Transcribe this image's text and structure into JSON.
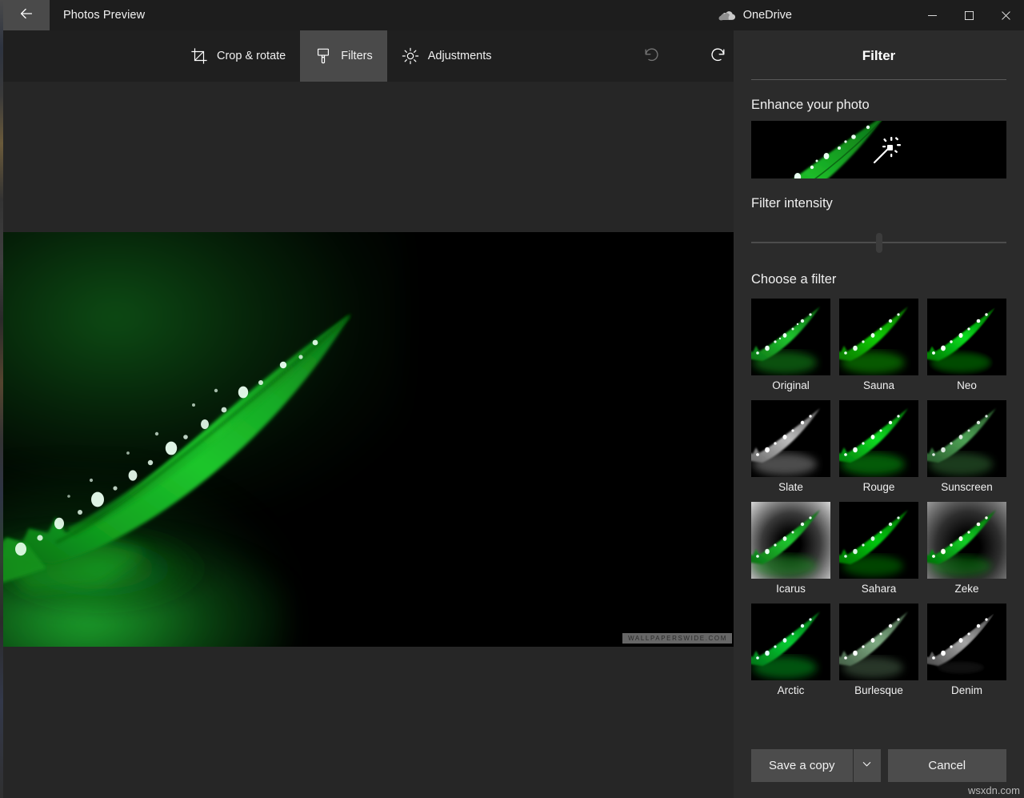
{
  "window": {
    "title": "Photos Preview",
    "back_icon": "back-arrow-icon",
    "onedrive_label": "OneDrive",
    "onedrive_icon": "cloud-icon",
    "minimize_label": "Minimize",
    "maximize_label": "Maximize",
    "close_label": "Close"
  },
  "toolbar": {
    "tabs": [
      {
        "label": "Crop & rotate",
        "icon": "crop-icon",
        "active": false
      },
      {
        "label": "Filters",
        "icon": "brush-icon",
        "active": true
      },
      {
        "label": "Adjustments",
        "icon": "brightness-icon",
        "active": false
      }
    ],
    "undo": {
      "label": "Undo",
      "icon": "undo-icon",
      "enabled": false
    },
    "redo": {
      "label": "Redo",
      "icon": "redo-icon",
      "enabled": true
    }
  },
  "photo": {
    "watermark": "WALLPAPERSWIDE.COM",
    "alt": "Green leaf with water droplets on black background"
  },
  "panel": {
    "title": "Filter",
    "enhance": {
      "heading": "Enhance your photo",
      "icon": "magic-wand-icon"
    },
    "intensity": {
      "heading": "Filter intensity",
      "value": 50,
      "min": 0,
      "max": 100
    },
    "choose": {
      "heading": "Choose a filter",
      "selected": "Original",
      "items": [
        {
          "label": "Original",
          "style": "original"
        },
        {
          "label": "Sauna",
          "style": "sauna"
        },
        {
          "label": "Neo",
          "style": "neo"
        },
        {
          "label": "Slate",
          "style": "slate"
        },
        {
          "label": "Rouge",
          "style": "rouge"
        },
        {
          "label": "Sunscreen",
          "style": "sunscreen"
        },
        {
          "label": "Icarus",
          "style": "icarus"
        },
        {
          "label": "Sahara",
          "style": "sahara"
        },
        {
          "label": "Zeke",
          "style": "zeke"
        },
        {
          "label": "Arctic",
          "style": "arctic"
        },
        {
          "label": "Burlesque",
          "style": "burlesque"
        },
        {
          "label": "Denim",
          "style": "denim"
        }
      ]
    },
    "actions": {
      "save_label": "Save a copy",
      "save_caret_icon": "chevron-down-icon",
      "cancel_label": "Cancel"
    }
  },
  "overlay": {
    "site_watermark": "wsxdn.com"
  },
  "colors": {
    "window_bg": "#1f1f1f",
    "titlebar_bg": "#1d1d1d",
    "panel_bg": "#2b2b2b",
    "tab_active_bg": "#4a4a4a",
    "button_bg": "#4c4c4c",
    "text": "#f0f0f0",
    "canvas_bg": "#262626"
  }
}
